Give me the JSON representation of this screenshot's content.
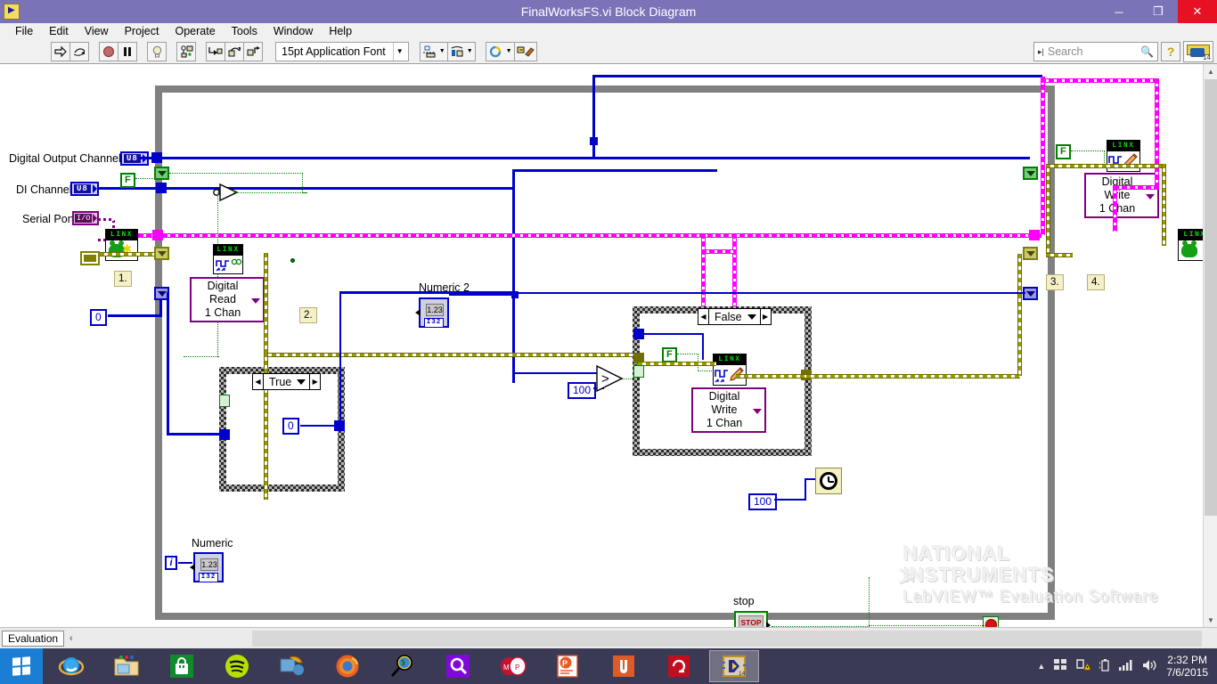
{
  "window": {
    "title": "FinalWorksFS.vi Block Diagram",
    "app_icon": "labview-vi-icon",
    "minimize": "─",
    "maximize": "❐",
    "close": "✕"
  },
  "menubar": {
    "items": [
      "File",
      "Edit",
      "View",
      "Project",
      "Operate",
      "Tools",
      "Window",
      "Help"
    ]
  },
  "toolbar": {
    "run": "run-arrow-icon",
    "run_continuously": "run-continuously-icon",
    "abort": "abort-execution-icon",
    "pause": "pause-icon",
    "highlight": "highlight-execution-icon",
    "retain_values": "retain-wire-values-icon",
    "step_into": "step-into-icon",
    "step_over": "step-over-icon",
    "step_out": "step-out-icon",
    "font_label": "15pt Application Font",
    "align_objects": "align-objects-icon",
    "distribute_objects": "distribute-objects-icon",
    "reorder": "reorder-icon",
    "clean_up": "clean-up-diagram-icon",
    "search_placeholder": "Search",
    "search_value": "",
    "search_icon": "magnifier-icon",
    "help_icon": "context-help-icon",
    "ni_badge": "14"
  },
  "statusbar": {
    "eval_tab": "Evaluation",
    "collapse": "‹"
  },
  "watermark": {
    "line1": "NATIONAL",
    "line2": "INSTRUMENTS",
    "line3": "LabVIEW™ Evaluation Software"
  },
  "diagram": {
    "terminals": [
      {
        "name": "digital-output-channel",
        "label": "Digital Output Channel",
        "type": "U8"
      },
      {
        "name": "di-channel",
        "label": "DI Channel",
        "type": "U8"
      },
      {
        "name": "serial-port",
        "label": "Serial Port",
        "type": "I/O"
      }
    ],
    "indicators": [
      {
        "name": "numeric-2",
        "label": "Numeric 2",
        "value": "1.23",
        "type": "I32"
      },
      {
        "name": "numeric",
        "label": "Numeric",
        "value": "1.23",
        "type": "I32"
      }
    ],
    "controls": [
      {
        "name": "stop-button",
        "label": "stop",
        "face": "STOP",
        "type": "TF"
      }
    ],
    "vis": [
      {
        "name": "linx-open",
        "header": "LINX",
        "icon": "linx-open-frog-icon"
      },
      {
        "name": "digital-read-vi",
        "header": "LINX",
        "icon": "linx-digital-read-icon",
        "label_line1": "Digital Read",
        "label_line2": "1 Chan"
      },
      {
        "name": "digital-write-vi-loop",
        "header": "LINX",
        "icon": "linx-digital-write-icon",
        "label_line1": "Digital Write",
        "label_line2": "1 Chan"
      },
      {
        "name": "digital-write-vi-top",
        "header": "LINX",
        "icon": "linx-digital-write-icon",
        "label_line1": "Digital Write",
        "label_line2": "1 Chan"
      },
      {
        "name": "linx-close",
        "header": "LINX",
        "icon": "linx-close-frog-icon"
      }
    ],
    "constants": [
      {
        "name": "false-constant-1",
        "value": "F"
      },
      {
        "name": "false-constant-2",
        "value": "F"
      },
      {
        "name": "false-constant-3",
        "value": "F"
      },
      {
        "name": "zero-constant-1",
        "value": "0"
      },
      {
        "name": "zero-constant-2",
        "value": "0"
      },
      {
        "name": "threshold-constant",
        "value": "100"
      },
      {
        "name": "wait-constant",
        "value": "100"
      }
    ],
    "case_structures": [
      {
        "name": "case-structure-true",
        "selector": "True"
      },
      {
        "name": "case-structure-false",
        "selector": "False"
      }
    ],
    "notes": [
      {
        "name": "note-1",
        "text": "1."
      },
      {
        "name": "note-2",
        "text": "2."
      },
      {
        "name": "note-3",
        "text": "3."
      },
      {
        "name": "note-4",
        "text": "4."
      }
    ],
    "primitives": [
      {
        "name": "not-gate",
        "glyph": "NOT"
      },
      {
        "name": "greater-than-gate",
        "glyph": ">"
      },
      {
        "name": "wait-ms-node",
        "glyph": "wait-clock-icon"
      },
      {
        "name": "iteration-terminal",
        "glyph": "i"
      }
    ],
    "colors": {
      "wire_blue": "#0000cc",
      "wire_pink": "#ff00ff",
      "wire_olive": "#808000",
      "wire_green": "#008000",
      "wire_purple": "#800080",
      "loop_border": "#808080"
    }
  },
  "taskbar": {
    "start": "windows-start-icon",
    "apps": [
      {
        "name": "internet-explorer",
        "icon": "ie-icon"
      },
      {
        "name": "file-explorer",
        "icon": "folder-icon"
      },
      {
        "name": "windows-store",
        "icon": "store-icon"
      },
      {
        "name": "spotify",
        "icon": "spotify-icon"
      },
      {
        "name": "sync-tool",
        "icon": "sync-icon"
      },
      {
        "name": "firefox",
        "icon": "firefox-icon"
      },
      {
        "name": "search-tool",
        "icon": "magnifier-globe-icon"
      },
      {
        "name": "search-app",
        "icon": "purple-magnifier-icon"
      },
      {
        "name": "mdp-app",
        "icon": "mdp-icon"
      },
      {
        "name": "powerpoint",
        "icon": "powerpoint-icon"
      },
      {
        "name": "office-app",
        "icon": "orange-app-icon"
      },
      {
        "name": "adobe-creative-cloud",
        "icon": "creative-cloud-icon"
      },
      {
        "name": "labview",
        "icon": "labview-icon",
        "badge": "14"
      }
    ],
    "tray": {
      "show_hidden": "▲",
      "icons": [
        "network-icon",
        "warning-icon",
        "battery-icon",
        "signal-icon",
        "volume-icon"
      ],
      "time": "2:32 PM",
      "date": "7/6/2015"
    }
  }
}
